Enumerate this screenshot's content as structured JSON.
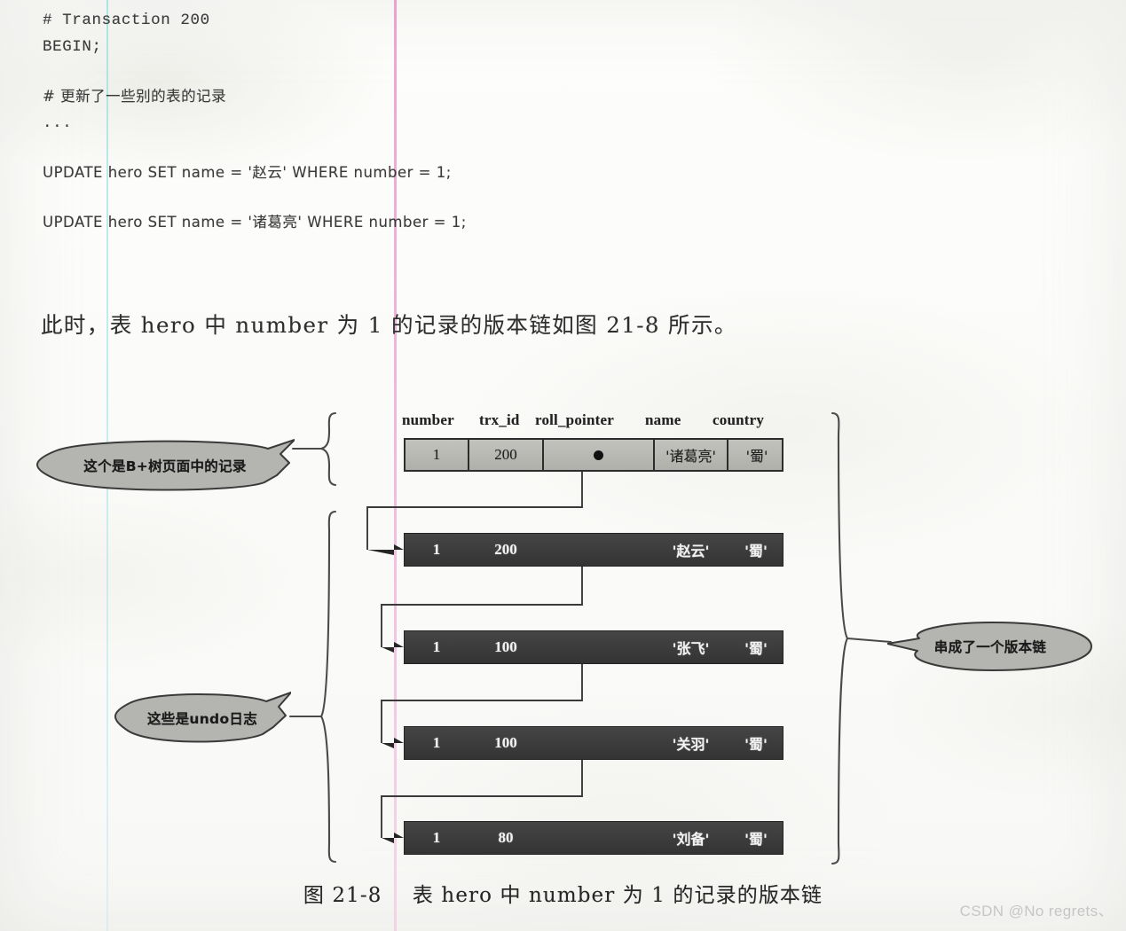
{
  "code": {
    "lines": [
      {
        "text": "# Transaction 200",
        "cjk": false
      },
      {
        "text": "BEGIN;",
        "cjk": false
      },
      {
        "text": "",
        "cjk": false
      },
      {
        "text": "# 更新了一些别的表的记录",
        "cjk": true
      },
      {
        "text": "...",
        "cjk": false
      },
      {
        "text": "",
        "cjk": false
      },
      {
        "text": "UPDATE hero SET name = '赵云' WHERE number = 1;",
        "cjk": true
      },
      {
        "text": "",
        "cjk": false
      },
      {
        "text": "UPDATE hero SET name = '诸葛亮' WHERE number = 1;",
        "cjk": true
      }
    ]
  },
  "prose": {
    "sentence": "此时，表 hero 中 number 为 1 的记录的版本链如图 21-8 所示。"
  },
  "figure": {
    "columns": [
      "number",
      "trx_id",
      "roll_pointer",
      "name",
      "country"
    ],
    "current_record": {
      "style": "b-tree-page-record",
      "number": "1",
      "trx_id": "200",
      "roll_pointer": "pointer-dot",
      "name": "'诸葛亮'",
      "country": "'蜀'"
    },
    "undo_logs": [
      {
        "number": "1",
        "trx_id": "200",
        "roll_pointer": "",
        "name": "'赵云'",
        "country": "'蜀'"
      },
      {
        "number": "1",
        "trx_id": "100",
        "roll_pointer": "",
        "name": "'张飞'",
        "country": "'蜀'"
      },
      {
        "number": "1",
        "trx_id": "100",
        "roll_pointer": "",
        "name": "'关羽'",
        "country": "'蜀'"
      },
      {
        "number": "1",
        "trx_id": "80",
        "roll_pointer": "",
        "name": "'刘备'",
        "country": "'蜀'"
      }
    ],
    "callouts": {
      "b_tree_record": "这个是B+树页面中的记录",
      "undo_logs": "这些是undo日志",
      "version_chain": "串成了一个版本链"
    },
    "caption": {
      "number": "图 21-8",
      "title": "表 hero 中 number 为 1 的记录的版本链"
    }
  },
  "watermark": {
    "text": "CSDN @No regrets、"
  },
  "colors": {
    "guide_cyan": "#9bdee0",
    "guide_pink": "#e98cc6",
    "record_light_fill": "#b9b9b4",
    "record_dark_fill": "#3b3b3b",
    "bubble_fill": "#b4b4b0",
    "ink": "#2c2c2c",
    "watermark": "#c6c6c6"
  }
}
